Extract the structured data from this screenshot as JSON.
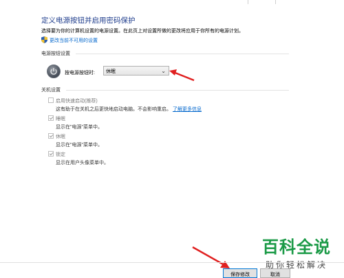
{
  "header": {
    "title": "定义电源按钮并启用密码保护",
    "description": "选择要为你的计算机设置的电源设置。在此页上对设置所做的更改将应用于你所有的电源计划。",
    "change_link": "更改当前不可用的设置"
  },
  "power_button": {
    "section_label": "电源按钮设置",
    "label": "按电源按钮时:",
    "selected": "休眠"
  },
  "shutdown": {
    "section_label": "关机设置",
    "options": [
      {
        "label": "启用快速启动(推荐)",
        "checked": false,
        "desc": "这有助于在关机之后更快地启动电脑。不会影响重启。",
        "link": "了解更多信息"
      },
      {
        "label": "睡眠",
        "checked": true,
        "desc": "显示在\"电源\"菜单中。"
      },
      {
        "label": "休眠",
        "checked": true,
        "desc": "显示在\"电源\"菜单中。"
      },
      {
        "label": "锁定",
        "checked": true,
        "desc": "显示在用户头像菜单中。"
      }
    ]
  },
  "footer": {
    "save_label": "保存修改",
    "cancel_label": "取消"
  },
  "watermark": {
    "top": "百科全说",
    "bottom": "助你轻松解决"
  },
  "colors": {
    "title": "#1e3c8c",
    "link": "#0066cc",
    "arrow": "#e02020",
    "watermark_green": "#1a9a46"
  }
}
